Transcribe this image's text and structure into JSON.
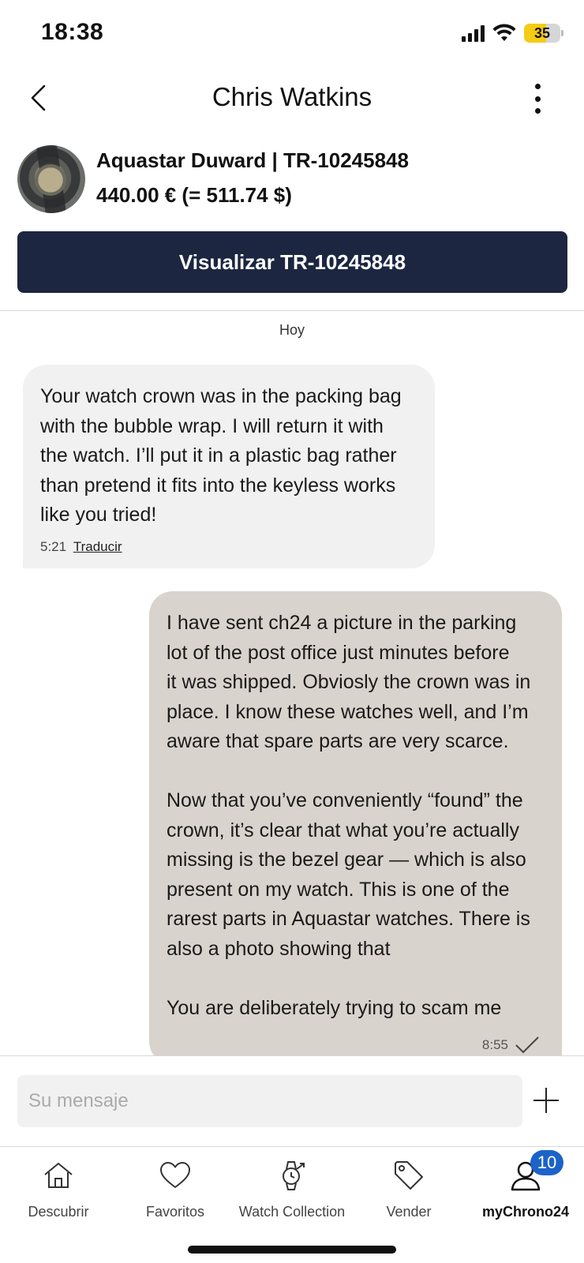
{
  "status_bar": {
    "time": "18:38",
    "battery": "35"
  },
  "header": {
    "title": "Chris Watkins"
  },
  "product": {
    "name": "Aquastar Duward | TR-10245848",
    "price": "440.00 € (= 511.74 $)",
    "view_button_label": "Visualizar TR-10245848"
  },
  "conversation": {
    "day_label": "Hoy",
    "messages": [
      {
        "direction": "incoming",
        "text": "Your watch crown was in the packing bag\nwith the bubble wrap. I will return it with\nthe watch. I’ll put it in a plastic bag rather\nthan pretend it fits into the keyless works\nlike you tried!",
        "time": "5:21",
        "translate_label": "Traducir"
      },
      {
        "direction": "outgoing",
        "text": "I have sent ch24 a picture in the parking\nlot of the post office just minutes before\nit was shipped. Obviosly the crown was in\nplace. I know these watches well, and I’m\naware that spare parts are very scarce.\n\nNow that you’ve conveniently “found” the\ncrown, it’s clear that what you’re actually\nmissing is the bezel gear — which is also\npresent on my watch. This is one of the\nrarest parts in Aquastar watches. There is\nalso a photo showing that\n\nYou are deliberately trying to scam me",
        "time": "8:55",
        "status_icon": "check-icon"
      }
    ]
  },
  "composer": {
    "placeholder": "Su mensaje"
  },
  "tabbar": {
    "tabs": [
      {
        "label": "Descubrir",
        "icon": "home-icon"
      },
      {
        "label": "Favoritos",
        "icon": "heart-icon"
      },
      {
        "label": "Watch Collection",
        "icon": "watch-icon"
      },
      {
        "label": "Vender",
        "icon": "tag-icon"
      },
      {
        "label": "myChrono24",
        "icon": "user-icon",
        "badge": "10",
        "active": true
      }
    ]
  },
  "colors": {
    "primary_button": "#1c2640",
    "incoming_bubble": "#f1f1f1",
    "outgoing_bubble": "#d9d3cd",
    "badge": "#1c63c8",
    "battery": "#f5cc15"
  }
}
